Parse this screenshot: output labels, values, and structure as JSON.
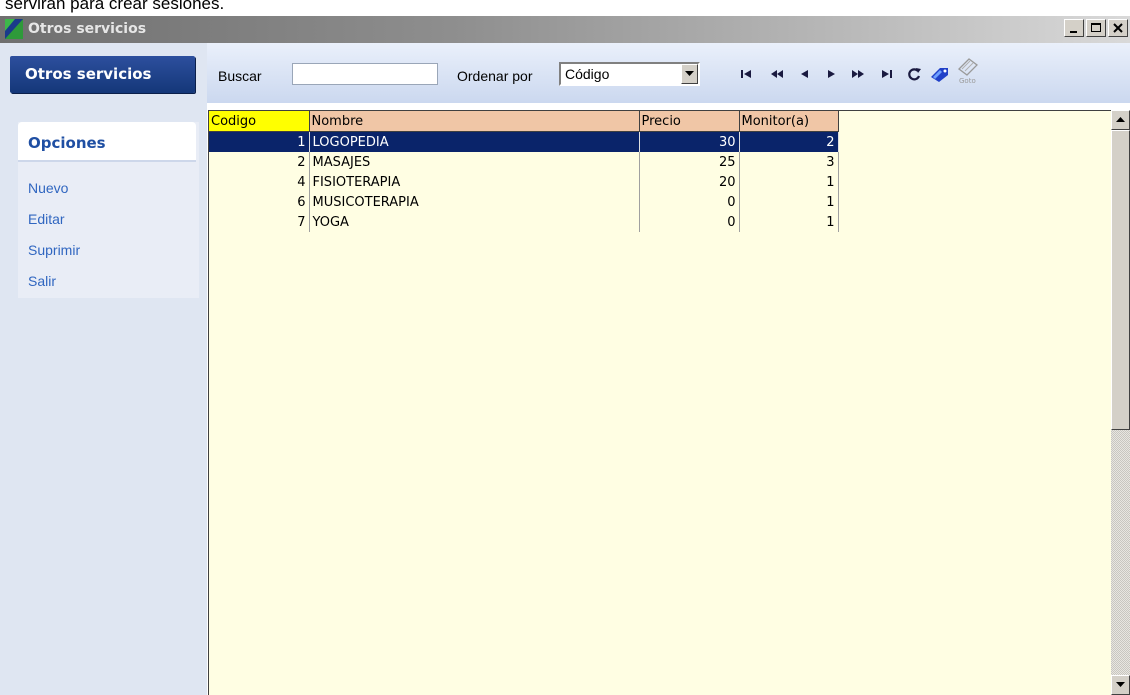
{
  "document_text": "servirán para crear sesiones.",
  "window": {
    "title": "Otros servicios"
  },
  "sidebar": {
    "header": "Otros servicios",
    "options_title": "Opciones",
    "links": [
      "Nuevo",
      "Editar",
      "Suprimir",
      "Salir"
    ]
  },
  "toolbar": {
    "search_label": "Buscar",
    "search_value": "",
    "order_label": "Ordenar por",
    "order_value": "Código",
    "nav_icons": [
      "first-record-icon",
      "previous-page-icon",
      "previous-record-icon",
      "next-record-icon",
      "next-page-icon",
      "last-record-icon",
      "refresh-icon",
      "tag-icon",
      "goto-icon"
    ],
    "goto_text": "Goto"
  },
  "grid": {
    "columns": [
      "Codigo",
      "Nombre",
      "Precio",
      "Monitor(a)"
    ],
    "sorted_column": "Codigo",
    "rows": [
      {
        "codigo": "1",
        "nombre": "LOGOPEDIA",
        "precio": "30",
        "monitor": "2",
        "selected": true
      },
      {
        "codigo": "2",
        "nombre": "MASAJES",
        "precio": "25",
        "monitor": "3"
      },
      {
        "codigo": "4",
        "nombre": "FISIOTERAPIA",
        "precio": "20",
        "monitor": "1"
      },
      {
        "codigo": "6",
        "nombre": "MUSICOTERAPIA",
        "precio": "0",
        "monitor": "1"
      },
      {
        "codigo": "7",
        "nombre": "YOGA",
        "precio": "0",
        "monitor": "1"
      }
    ]
  },
  "colors": {
    "selected_row": "#0a246a",
    "header_bg": "#f0c6a6",
    "sorted_header": "#ffff00",
    "grid_bg": "#fffee3",
    "sidebar_header": "#1e3f8a"
  }
}
